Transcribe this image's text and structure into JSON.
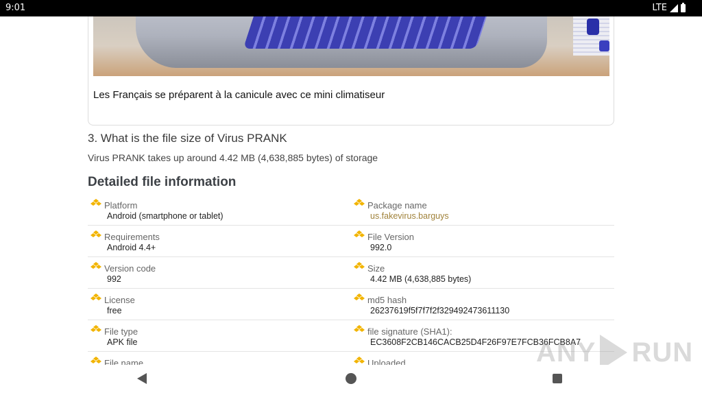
{
  "status_bar": {
    "time": "9:01",
    "network": "LTE"
  },
  "ad": {
    "caption": "Les Français se préparent à la canicule avec ce mini climatiseur"
  },
  "faq": {
    "question": "3. What is the file size of Virus PRANK",
    "answer": "Virus PRANK takes up around 4.42 MB (4,638,885 bytes) of storage"
  },
  "details": {
    "title": "Detailed file information",
    "rows": [
      {
        "label": "Platform",
        "value": "Android (smartphone or tablet)"
      },
      {
        "label": "Package name",
        "value": "us.fakevirus.barguys"
      },
      {
        "label": "Requirements",
        "value": "Android 4.4+"
      },
      {
        "label": "File Version",
        "value": "992.0"
      },
      {
        "label": "Version code",
        "value": "992"
      },
      {
        "label": "Size",
        "value": "4.42 MB (4,638,885 bytes)"
      },
      {
        "label": "License",
        "value": "free"
      },
      {
        "label": "md5 hash",
        "value": "26237619f5f7f7f2f329492473611130"
      },
      {
        "label": "File type",
        "value": "APK file"
      },
      {
        "label": "file signature (SHA1):",
        "value": "EC3608F2CB146CACB25D4F26F97E7FCB36FCB8A7"
      },
      {
        "label": "File name",
        "value": ""
      },
      {
        "label": "Uploaded",
        "value": ""
      }
    ]
  },
  "watermark": {
    "left": "ANY",
    "right": "RUN"
  },
  "icons": {
    "info": "stack-icon",
    "accent_color": "#f2b400"
  }
}
